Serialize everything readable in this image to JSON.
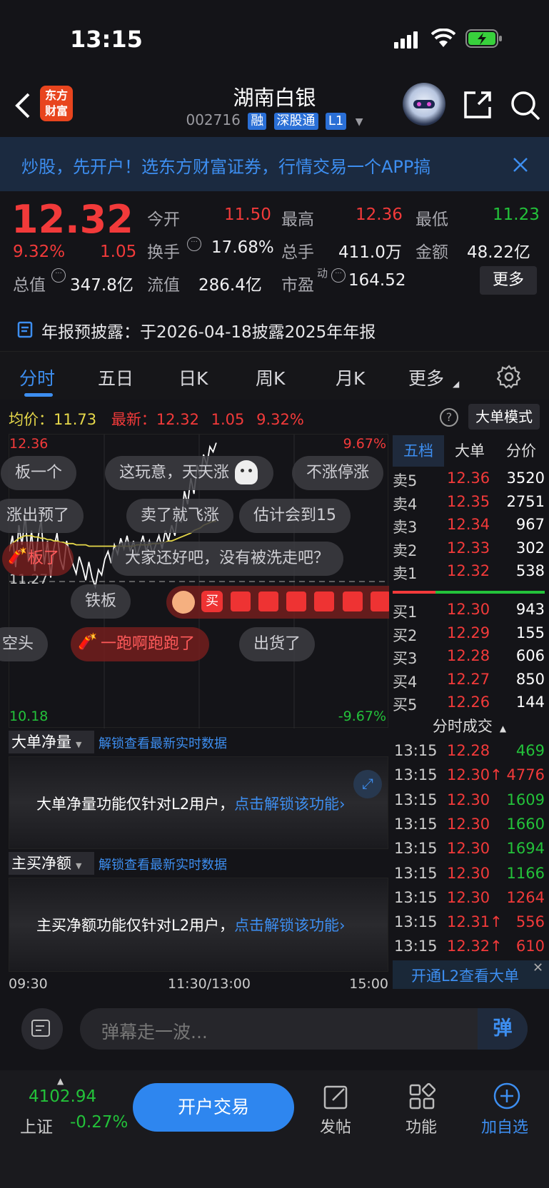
{
  "status": {
    "time": "13:15"
  },
  "header": {
    "title": "湖南白银",
    "code": "002716",
    "tags": [
      "融",
      "深股通",
      "L1"
    ],
    "logo_line1": "东方",
    "logo_line2": "财富"
  },
  "banner": {
    "text": "炒股，先开户！选东方财富证券，行情交易一个APP搞"
  },
  "quote": {
    "price": "12.32",
    "pct": "9.32%",
    "change": "1.05",
    "open_label": "今开",
    "open": "11.50",
    "high_label": "最高",
    "high": "12.36",
    "low_label": "最低",
    "low": "11.23",
    "turnover_label": "换手",
    "turnover": "17.68%",
    "volume_label": "总手",
    "volume": "411.0万",
    "amount_label": "金额",
    "amount": "48.22亿",
    "mktcap_label": "总值",
    "mktcap": "347.8亿",
    "float_label": "流值",
    "float": "286.4亿",
    "pe_label": "市盈",
    "pe_sup": "动",
    "pe": "164.52",
    "more": "更多"
  },
  "notice": {
    "text": "年报预披露：于2026-04-18披露2025年年报"
  },
  "tabs": [
    "分时",
    "五日",
    "日K",
    "周K",
    "月K",
    "更多"
  ],
  "chart_info": {
    "avg_label": "均价：",
    "avg": "11.73",
    "last_label": "最新：",
    "last": "12.32",
    "chg": "1.05",
    "pct": "9.32%",
    "mode": "大单模式"
  },
  "chart_data": {
    "type": "line",
    "title": "",
    "ylim": [
      10.18,
      12.36
    ],
    "y_ticks_left": [
      "12.36",
      "11.27",
      "10.18"
    ],
    "y_ticks_right": [
      "9.67%",
      "-9.67%"
    ],
    "x_ticks": [
      "09:30",
      "11:30/13:00",
      "15:00"
    ],
    "series": [
      {
        "name": "",
        "color": "#ffffff",
        "values": [
          11.5,
          11.62,
          11.38,
          11.7,
          11.55,
          11.78,
          11.42,
          11.66,
          11.35,
          11.6,
          11.74,
          11.4,
          11.58,
          11.3,
          11.52,
          11.64,
          11.44,
          11.36,
          11.58,
          11.48,
          11.4,
          11.33,
          11.46,
          11.38,
          11.28,
          11.42,
          11.3,
          11.23,
          11.36,
          11.32,
          11.44,
          11.5,
          11.41,
          11.55,
          11.48,
          11.6,
          11.52,
          11.62,
          11.5,
          11.58,
          11.46,
          11.54,
          11.62,
          11.5,
          11.58,
          11.48,
          11.55,
          11.62,
          11.52,
          11.66,
          11.58,
          11.7,
          11.62,
          11.8,
          11.72,
          11.96,
          11.86,
          12.06,
          11.94,
          12.16,
          12.06,
          12.24,
          12.16,
          12.3,
          12.26,
          12.33
        ]
      },
      {
        "name": "",
        "color": "#e6d84a",
        "values": [
          11.52,
          11.56,
          11.58,
          11.6,
          11.61,
          11.62,
          11.62,
          11.62,
          11.61,
          11.61,
          11.6,
          11.6,
          11.59,
          11.59,
          11.58,
          11.58,
          11.57,
          11.57,
          11.56,
          11.56,
          11.56,
          11.55,
          11.55,
          11.55,
          11.55,
          11.54,
          11.54,
          11.54,
          11.54,
          11.54,
          11.54,
          11.54,
          11.54,
          11.54,
          11.54,
          11.54,
          11.54,
          11.54,
          11.54,
          11.54,
          11.55,
          11.55,
          11.55,
          11.55,
          11.55,
          11.56,
          11.56,
          11.56,
          11.57,
          11.57,
          11.58,
          11.58,
          11.59,
          11.6,
          11.61,
          11.62,
          11.63,
          11.64,
          11.66,
          11.67,
          11.68,
          11.7,
          11.71,
          11.72,
          11.73,
          11.73
        ]
      }
    ]
  },
  "bullets": [
    {
      "text": "板一个",
      "style": "gray"
    },
    {
      "text": "这玩意，天天涨",
      "style": "gray"
    },
    {
      "text": "不涨停涨",
      "style": "gray"
    },
    {
      "text": "涨出预了",
      "style": "gray"
    },
    {
      "text": "卖了就飞涨",
      "style": "gray"
    },
    {
      "text": "估计会到15",
      "style": "gray"
    },
    {
      "text": "板了",
      "style": "red"
    },
    {
      "text": "大家还好吧，没有被洗走吧？",
      "style": "gray"
    },
    {
      "text": "铁板",
      "style": "gray"
    },
    {
      "text": "空头",
      "style": "gray"
    },
    {
      "text": "一跑啊跑跑了",
      "style": "red"
    },
    {
      "text": "出货了",
      "style": "gray"
    }
  ],
  "indicators": [
    {
      "name": "大单净量",
      "unlock": "解锁查看最新实时数据",
      "msg": "大单净量功能仅针对L2用户，",
      "link": "点击解锁该功能"
    },
    {
      "name": "主买净额",
      "unlock": "解锁查看最新实时数据",
      "msg": "主买净额功能仅针对L2用户，",
      "link": "点击解锁该功能"
    }
  ],
  "orderbook": {
    "tabs": [
      "五档",
      "大单",
      "分价"
    ],
    "asks": [
      {
        "label": "卖5",
        "price": "12.36",
        "vol": "3520"
      },
      {
        "label": "卖4",
        "price": "12.35",
        "vol": "2751"
      },
      {
        "label": "卖3",
        "price": "12.34",
        "vol": "967"
      },
      {
        "label": "卖2",
        "price": "12.33",
        "vol": "302"
      },
      {
        "label": "卖1",
        "price": "12.32",
        "vol": "538"
      }
    ],
    "bids": [
      {
        "label": "买1",
        "price": "12.30",
        "vol": "943"
      },
      {
        "label": "买2",
        "price": "12.29",
        "vol": "155"
      },
      {
        "label": "买3",
        "price": "12.28",
        "vol": "606"
      },
      {
        "label": "买4",
        "price": "12.27",
        "vol": "850"
      },
      {
        "label": "买5",
        "price": "12.26",
        "vol": "144"
      }
    ]
  },
  "trades": {
    "title": "分时成交",
    "rows": [
      {
        "time": "13:15",
        "price": "12.28",
        "vol": "469",
        "pc": "red",
        "vc": "green"
      },
      {
        "time": "13:15",
        "price": "12.30↑",
        "vol": "4776",
        "pc": "red",
        "vc": "red"
      },
      {
        "time": "13:15",
        "price": "12.30",
        "vol": "1609",
        "pc": "red",
        "vc": "green"
      },
      {
        "time": "13:15",
        "price": "12.30",
        "vol": "1660",
        "pc": "red",
        "vc": "green"
      },
      {
        "time": "13:15",
        "price": "12.30",
        "vol": "1694",
        "pc": "red",
        "vc": "green"
      },
      {
        "time": "13:15",
        "price": "12.30",
        "vol": "1166",
        "pc": "red",
        "vc": "green"
      },
      {
        "time": "13:15",
        "price": "12.30",
        "vol": "1264",
        "pc": "red",
        "vc": "red"
      },
      {
        "time": "13:15",
        "price": "12.31↑",
        "vol": "556",
        "pc": "red",
        "vc": "red"
      },
      {
        "time": "13:15",
        "price": "12.32↑",
        "vol": "610",
        "pc": "red",
        "vc": "red"
      }
    ],
    "l2": "开通L2查看大单"
  },
  "danmu": {
    "placeholder": "弹幕走一波...",
    "btn": "弹"
  },
  "bottom": {
    "index_value": "4102.94",
    "index_name": "上证",
    "index_pct": "-0.27%",
    "trade_btn": "开户交易",
    "nav": [
      "发帖",
      "功能",
      "加自选"
    ]
  }
}
